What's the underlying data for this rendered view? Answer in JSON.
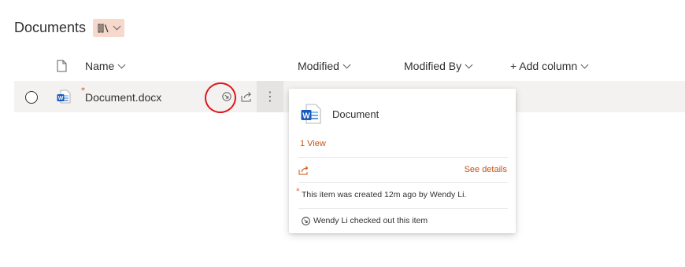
{
  "page": {
    "title": "Documents",
    "view_icon": "library-icon"
  },
  "columns": {
    "name": "Name",
    "modified": "Modified",
    "modified_by": "Modified By",
    "add_column": "+ Add column"
  },
  "file_row": {
    "name": "Document.docx",
    "icon": "word-icon",
    "status_icon": "checked-out-icon"
  },
  "hover_card": {
    "title": "Document",
    "views": "1 View",
    "see_details": "See details",
    "activity_created": "This item was created 12m ago by Wendy Li.",
    "activity_checked_out": "Wendy Li checked out this item"
  },
  "colors": {
    "accent": "#ca5010",
    "word_blue": "#185abd",
    "annotation_red": "#e0151b"
  }
}
